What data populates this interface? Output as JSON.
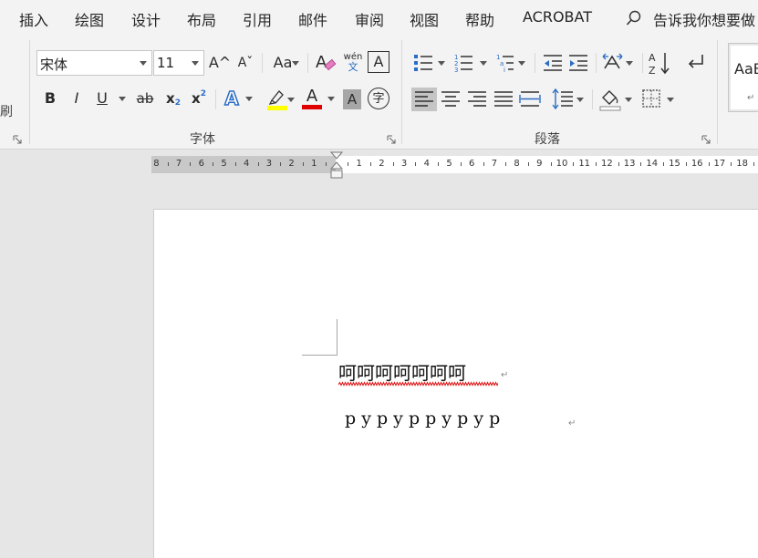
{
  "tabs": [
    "插入",
    "绘图",
    "设计",
    "布局",
    "引用",
    "邮件",
    "审阅",
    "视图",
    "帮助",
    "ACROBAT"
  ],
  "tell_me": "告诉我你想要做",
  "clipboard_stub_label": "刷",
  "font_group": {
    "label": "字体",
    "font_name": "宋体",
    "font_size": "11",
    "grow_font": "A^",
    "shrink_font": "Aˇ",
    "change_case": "Aa",
    "phonetic_top": "wén",
    "phonetic_bottom": "文",
    "char_border": "A",
    "bold": "B",
    "italic": "I",
    "underline": "U",
    "strikethrough": "ab",
    "subscript": "x",
    "subscript_mark": "2",
    "superscript": "x",
    "superscript_mark": "2",
    "text_effects": "A",
    "font_color": "A",
    "char_shading": "A",
    "enclose_char": "字",
    "highlight_color": "#ffff00",
    "font_color_value": "#e00000"
  },
  "paragraph_group": {
    "label": "段落"
  },
  "styles": {
    "sample": "AaB",
    "mark": "↵"
  },
  "ruler": {
    "left_numbers": [
      "8",
      "7",
      "6",
      "5",
      "4",
      "3",
      "2",
      "1"
    ],
    "right_numbers": [
      "1",
      "2",
      "3",
      "4",
      "5",
      "6",
      "7",
      "8",
      "9",
      "10",
      "11",
      "12",
      "13",
      "14",
      "15",
      "16",
      "17",
      "18"
    ]
  },
  "document": {
    "line1": "呵呵呵呵呵呵呵",
    "line2": "p y p y p p y p y p",
    "paragraph_mark": "↵"
  },
  "colors": {
    "accent_blue": "#2b6cc4",
    "squiggle": "#e02020"
  }
}
